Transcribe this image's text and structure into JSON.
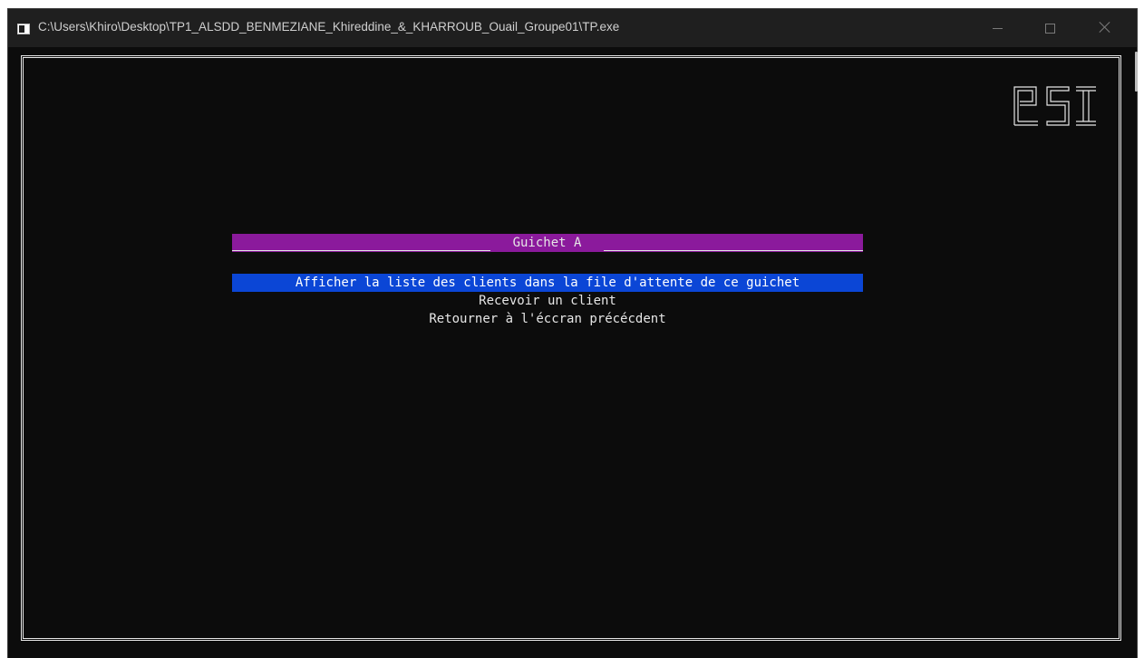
{
  "window": {
    "title": "C:\\Users\\Khiro\\Desktop\\TP1_ALSDD_BENMEZIANE_Khireddine_&_KHARROUB_Ouail_Groupe01\\TP.exe",
    "app_icon": "console-app-icon",
    "controls": {
      "minimize_icon": "minimize-icon",
      "maximize_icon": "maximize-icon",
      "close_icon": "close-icon"
    }
  },
  "console": {
    "logo_text": "esi",
    "header": {
      "title": " Guichet A "
    },
    "menu": {
      "items": [
        {
          "label": "Afficher la liste des clients dans la file d'attente de ce guichet",
          "selected": true
        },
        {
          "label": "Recevoir un client",
          "selected": false
        },
        {
          "label": "Retourner à l'éccran précécdent",
          "selected": false
        }
      ]
    }
  },
  "colors": {
    "console_background": "#0c0c0c",
    "console_text": "#e6e6e6",
    "header_bar": "#8b1a9c",
    "selection_highlight": "#0b46d6",
    "titlebar": "#1f1f1f"
  }
}
